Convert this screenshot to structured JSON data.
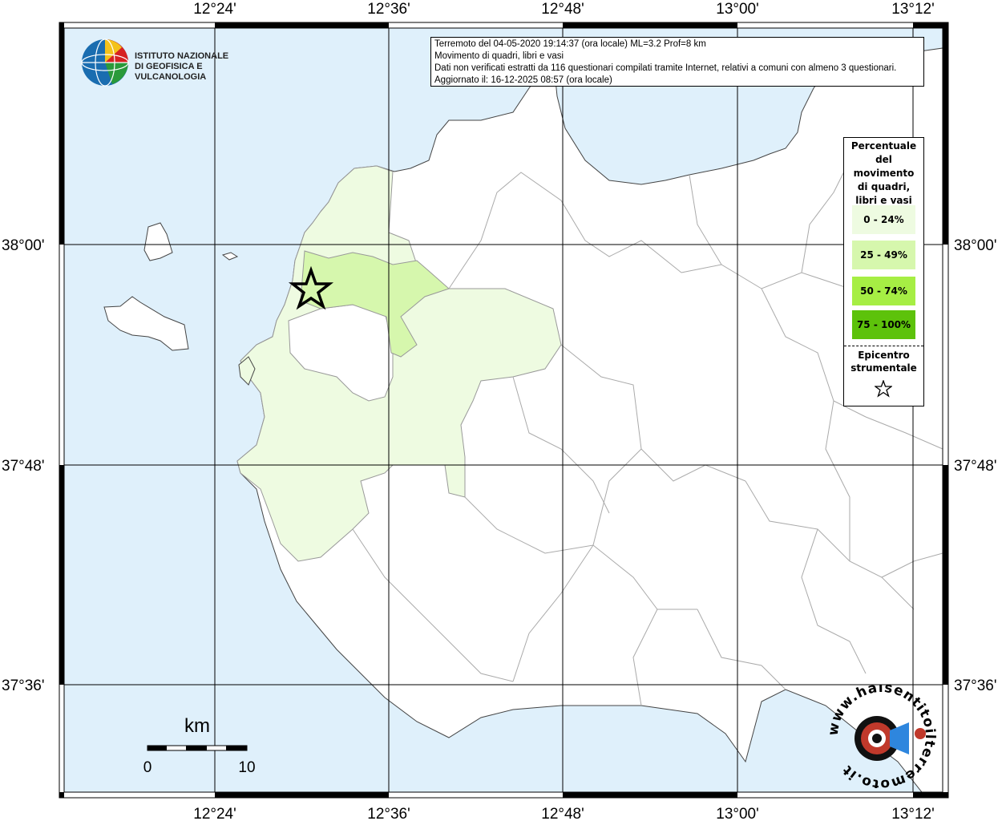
{
  "info": {
    "line1": "Terremoto del 04-05-2020 19:14:37 (ora locale) ML=3.2 Prof=8 km",
    "line2": "Movimento di quadri, libri e vasi",
    "line3": "Dati non verificati estratti da 116 questionari compilati tramite Internet, relativi a comuni con almeno 3 questionari.",
    "line4": "Aggiornato il: 16-12-2025 08:57 (ora locale)"
  },
  "legend": {
    "title": "Percentuale del movimento di quadri, libri e vasi",
    "title_lines": [
      "Percentuale",
      "del",
      "movimento",
      "di quadri,",
      "libri e vasi"
    ],
    "items": [
      {
        "label": "0 - 24%",
        "color": "#eefbe1"
      },
      {
        "label": "25 - 49%",
        "color": "#d6f7ad"
      },
      {
        "label": "50 - 74%",
        "color": "#a6ee44"
      },
      {
        "label": "75 - 100%",
        "color": "#5dc20b"
      }
    ],
    "epicenter_lines": [
      "Epicentro",
      "strumentale"
    ]
  },
  "axes": {
    "top": [
      "12°24'",
      "12°36'",
      "12°48'",
      "13°00'",
      "13°12'"
    ],
    "bottom": [
      "12°24'",
      "12°36'",
      "12°48'",
      "13°00'",
      "13°12'"
    ],
    "left": [
      "38°00'",
      "37°48'",
      "37°36'"
    ],
    "right": [
      "38°00'",
      "37°48'",
      "37°36'"
    ]
  },
  "scale": {
    "unit": "km",
    "min": "0",
    "max": "10"
  },
  "logos": {
    "ingv_line1": "ISTITUTO NAZIONALE",
    "ingv_line2": "DI GEOFISICA E VULCANOLOGIA",
    "hst_text": "www.haisentitoilterremoto.it"
  },
  "colors": {
    "sea": "#dff0fb",
    "land": "#ffffff",
    "class1": "#eefbe1",
    "class2": "#d6f7ad",
    "grid": "#000000"
  }
}
